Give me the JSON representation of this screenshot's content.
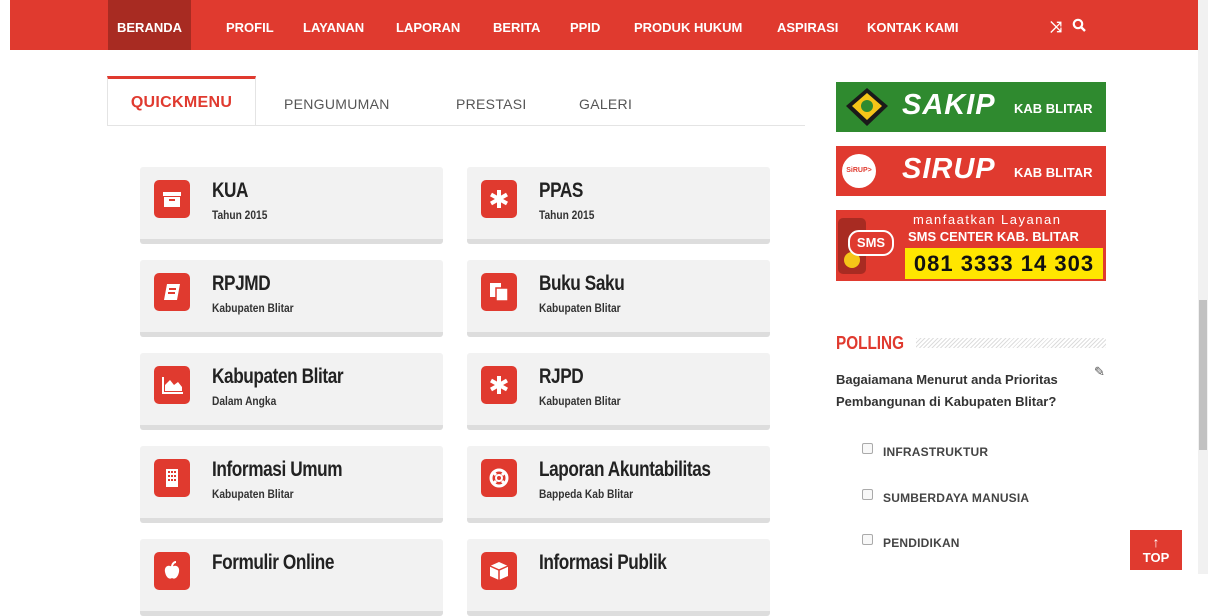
{
  "nav": {
    "items": [
      "BERANDA",
      "PROFIL",
      "LAYANAN",
      "LAPORAN",
      "BERITA",
      "PPID",
      "PRODUK HUKUM",
      "ASPIRASI",
      "KONTAK KAMI"
    ],
    "active": "BERANDA",
    "shuffle_icon": "shuffle-icon",
    "search_icon": "search-icon"
  },
  "tabs": [
    "QUICKMENU",
    "PENGUMUMAN",
    "PRESTASI",
    "GALERI"
  ],
  "quickmenu": [
    {
      "title": "KUA",
      "subtitle": "Tahun 2015",
      "icon": "archive-icon"
    },
    {
      "title": "PPAS",
      "subtitle": "Tahun 2015",
      "icon": "asterisk-icon"
    },
    {
      "title": "RPJMD",
      "subtitle": "Kabupaten Blitar",
      "icon": "book-icon"
    },
    {
      "title": "Buku Saku",
      "subtitle": "Kabupaten Blitar",
      "icon": "copy-icon"
    },
    {
      "title": "Kabupaten Blitar",
      "subtitle": "Dalam Angka",
      "icon": "area-chart-icon"
    },
    {
      "title": "RJPD",
      "subtitle": "Kabupaten Blitar",
      "icon": "asterisk-icon"
    },
    {
      "title": "Informasi Umum",
      "subtitle": "Kabupaten Blitar",
      "icon": "building-icon"
    },
    {
      "title": "Laporan Akuntabilitas",
      "subtitle": "Bappeda Kab Blitar",
      "icon": "life-ring-icon"
    },
    {
      "title": "Formulir Online",
      "subtitle": "",
      "icon": "apple-icon"
    },
    {
      "title": "Informasi Publik",
      "subtitle": "",
      "icon": "cube-icon"
    }
  ],
  "banners": {
    "sakip": {
      "big": "SAKIP",
      "small": "KAB BLITAR",
      "color": "#2f8a2f"
    },
    "sirup": {
      "big": "SIRUP",
      "small": "KAB BLITAR",
      "logo": "SiRUP>"
    },
    "sms": {
      "line1": "manfaatkan Layanan",
      "line2": "SMS CENTER KAB. BLITAR",
      "badge": "SMS",
      "number": "081 3333 14 303"
    }
  },
  "poll": {
    "title": "POLLING",
    "question": "Bagaiamana Menurut anda Prioritas Pembangunan di Kabupaten Blitar?",
    "options": [
      "INFRASTRUKTUR",
      "SUMBERDAYA MANUSIA",
      "PENDIDIKAN"
    ]
  },
  "top_button": {
    "label": "TOP"
  },
  "colors": {
    "accent": "#e03a2f",
    "dark_accent": "#a82b22",
    "sakip_green": "#2f8a2f",
    "sms_yellow": "#ffe600"
  }
}
